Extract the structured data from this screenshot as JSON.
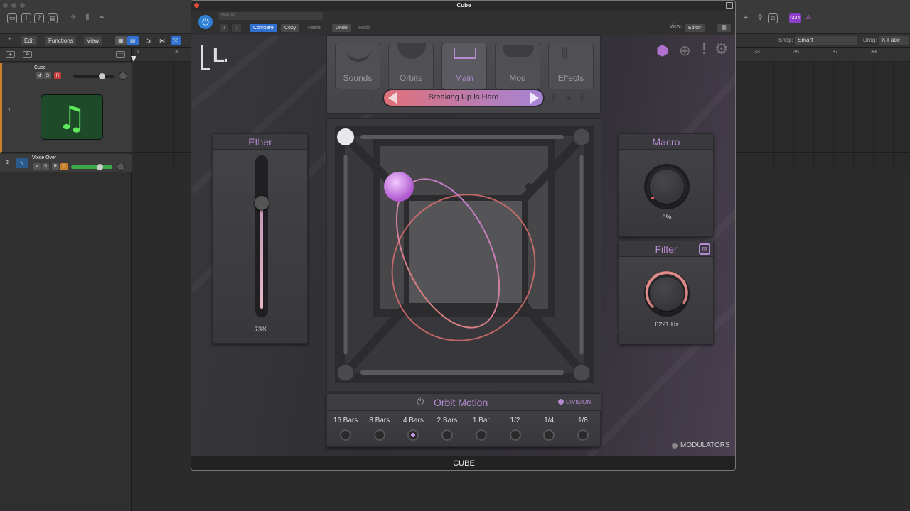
{
  "daw": {
    "menus": {
      "edit": "Edit",
      "functions": "Functions",
      "view": "View"
    },
    "snap_label": "Snap:",
    "snap_value": "Smart",
    "drag_label": "Drag:",
    "drag_value": "X-Fade",
    "lcd_badge": "⁵234",
    "ruler": [
      "1",
      "3",
      "33",
      "35",
      "37",
      "39"
    ],
    "tracks": [
      {
        "number": "1",
        "name": "Cube",
        "m": "M",
        "s": "S",
        "r": "R"
      },
      {
        "number": "2",
        "name": "Voice Over",
        "m": "M",
        "s": "S",
        "r": "R",
        "i": "I"
      }
    ]
  },
  "plugin": {
    "window_title": "Cube",
    "preset_field": "Manual",
    "compare": "Compare",
    "copy": "Copy",
    "paste": "Paste",
    "undo": "Undo",
    "redo": "Redo",
    "view_label": "View:",
    "view_value": "Editor",
    "footer": "CUBE",
    "logo": "L.",
    "tabs": [
      "Sounds",
      "Orbits",
      "Main",
      "Mod",
      "Effects"
    ],
    "active_tab": "Main",
    "preset_name": "Breaking Up Is Hard",
    "ether": {
      "title": "Ether",
      "value": "73%",
      "level": 0.73
    },
    "macro": {
      "title": "Macro",
      "value": "0%"
    },
    "filter": {
      "title": "Filter",
      "value": "6221 Hz"
    },
    "orbit": {
      "title": "Orbit Motion",
      "division": "DIVISION",
      "rates": [
        "16 Bars",
        "8 Bars",
        "4 Bars",
        "2 Bars",
        "1 Bar",
        "1/2",
        "1/4",
        "1/8"
      ],
      "selected": "4 Bars"
    },
    "modulators": "MODULATORS"
  },
  "colors": {
    "accent": "#b58ad0",
    "preset_bar": "#e0707a",
    "power": "#2f7fd4"
  }
}
